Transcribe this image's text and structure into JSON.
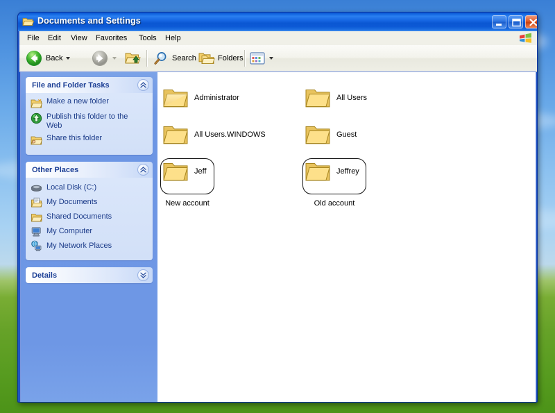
{
  "window": {
    "title": "Documents and Settings",
    "titlebar_icon": "open-folder-icon",
    "controls": {
      "minimize": "Minimize",
      "maximize": "Maximize",
      "close": "Close"
    }
  },
  "menubar": {
    "items": [
      {
        "label": "File"
      },
      {
        "label": "Edit"
      },
      {
        "label": "View"
      },
      {
        "label": "Favorites"
      },
      {
        "label": "Tools"
      },
      {
        "label": "Help"
      }
    ],
    "logo": "windows-flag-icon"
  },
  "toolbar": {
    "back_label": "Back",
    "forward_label": "",
    "up_label": "",
    "search_label": "Search",
    "folders_label": "Folders",
    "views_label": ""
  },
  "sidebar": {
    "panels": [
      {
        "title": "File and Folder Tasks",
        "state": "expanded",
        "chevron": "chevron-up-icon",
        "items": [
          {
            "label": "Make a new folder",
            "icon": "new-folder-icon"
          },
          {
            "label": "Publish this folder to the Web",
            "icon": "publish-web-icon"
          },
          {
            "label": "Share this folder",
            "icon": "share-folder-icon"
          }
        ]
      },
      {
        "title": "Other Places",
        "state": "expanded",
        "chevron": "chevron-up-icon",
        "items": [
          {
            "label": "Local Disk (C:)",
            "icon": "hard-disk-icon"
          },
          {
            "label": "My Documents",
            "icon": "my-documents-icon"
          },
          {
            "label": "Shared Documents",
            "icon": "shared-documents-icon"
          },
          {
            "label": "My Computer",
            "icon": "my-computer-icon"
          },
          {
            "label": "My Network Places",
            "icon": "network-places-icon"
          }
        ]
      },
      {
        "title": "Details",
        "state": "collapsed",
        "chevron": "chevron-down-icon",
        "items": []
      }
    ]
  },
  "files": {
    "view_mode": "tiles",
    "items": [
      {
        "name": "Administrator",
        "icon": "folder-icon",
        "selected": false,
        "annotated": false
      },
      {
        "name": "All Users",
        "icon": "folder-icon",
        "selected": false,
        "annotated": false
      },
      {
        "name": "All Users.WINDOWS",
        "icon": "folder-icon",
        "selected": false,
        "annotated": false
      },
      {
        "name": "Guest",
        "icon": "folder-icon",
        "selected": false,
        "annotated": false
      },
      {
        "name": "Jeff",
        "icon": "folder-icon",
        "selected": false,
        "annotated": true,
        "annotation": "New account"
      },
      {
        "name": "Jeffrey",
        "icon": "folder-icon",
        "selected": false,
        "annotated": true,
        "annotation": "Old account"
      }
    ],
    "annotations": [
      {
        "caption": "New account"
      },
      {
        "caption": "Old account"
      }
    ]
  },
  "colors": {
    "titlebar_blue": "#1667e2",
    "sidebar_blue": "#6f97e5",
    "panel_body": "#d6e2f9",
    "panel_title_text": "#1c3f95",
    "link_text": "#1a3a88",
    "folder_yellow": "#fde08a",
    "annotation_outline": "#111111",
    "desktop_sky": "#4f93e0",
    "desktop_grass": "#78ad2c"
  }
}
